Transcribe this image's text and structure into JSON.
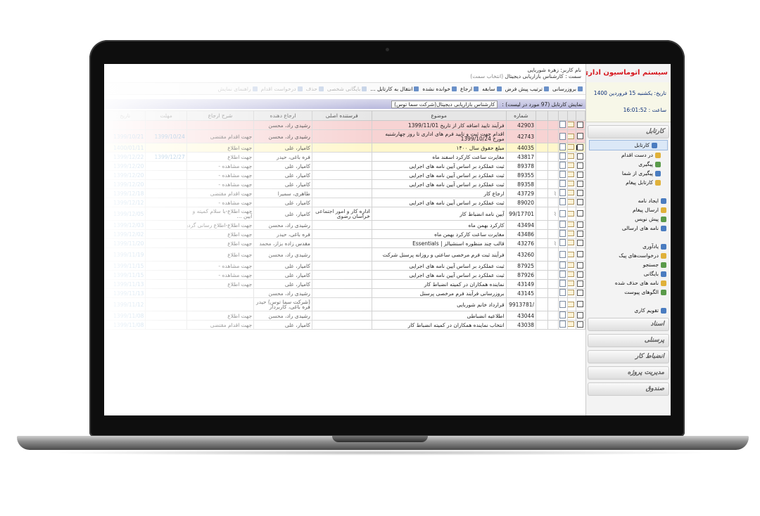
{
  "app": {
    "title": "سیستم اتوماسیون اداری پیوند",
    "date": "تاریخ: یکشنبه 15 فروردین 1400",
    "time": "ساعت : 16:01:52"
  },
  "user": {
    "name": "نام کاربر: زهره شوربایی",
    "role": "سمت : کارشناس بازاریابی دیجیتال",
    "role_hint": "(انتخاب سمت)"
  },
  "sidebar": {
    "sections": [
      {
        "label": "کارتابل",
        "items": [
          {
            "label": "کارتابل",
            "active": true,
            "sub": true,
            "icon": "inbox-icon"
          },
          {
            "label": "در دست اقدام",
            "sub": true,
            "icon": "folder-icon"
          },
          {
            "label": "پیگیری",
            "sub": true,
            "icon": "folder-icon"
          },
          {
            "label": "پیگیری از شما",
            "sub": true,
            "icon": "folder-icon"
          },
          {
            "label": "کارتابل پیغام",
            "sub": true,
            "icon": "message-icon"
          }
        ]
      },
      {
        "label": "",
        "items": [
          {
            "label": "ایجاد نامه",
            "icon": "new-letter-icon"
          },
          {
            "label": "ارسال پیغام",
            "icon": "send-icon"
          },
          {
            "label": "پیش نویس",
            "icon": "draft-icon"
          },
          {
            "label": "نامه های ارسالی",
            "icon": "sent-icon"
          }
        ]
      },
      {
        "label": "",
        "items": [
          {
            "label": "یادآوری",
            "icon": "reminder-icon"
          },
          {
            "label": "درخواست‌های پیک",
            "icon": "courier-icon"
          },
          {
            "label": "جستجو",
            "icon": "search-icon"
          },
          {
            "label": "بایگانی",
            "icon": "archive-icon"
          },
          {
            "label": "نامه های حذف شده",
            "icon": "trash-icon"
          },
          {
            "label": "الگوهای پیوست",
            "icon": "attachment-icon"
          }
        ]
      },
      {
        "label": "",
        "items": [
          {
            "label": "تقویم کاری",
            "icon": "calendar-icon"
          }
        ]
      }
    ],
    "modules": [
      "اسناد",
      "پرسنلی",
      "انضباط کار",
      "مدیریت پروژه",
      "صندوق"
    ]
  },
  "toolbar": [
    {
      "label": "بروزرسانی",
      "faded": false
    },
    {
      "label": "ترتیب پیش فرض",
      "faded": false
    },
    {
      "label": "سابقه",
      "faded": false
    },
    {
      "label": "ارجاع",
      "faded": false
    },
    {
      "label": "خوانده نشده",
      "faded": false
    },
    {
      "label": "انتقال به کارتابل ...",
      "faded": false
    },
    {
      "label": "بایگانی شخصی",
      "faded": true
    },
    {
      "label": "حذف",
      "faded": true
    },
    {
      "label": "درخواست اقدام",
      "faded": true
    },
    {
      "label": "راهنمای نمایش",
      "faded": true
    }
  ],
  "cartable_title": "نمایش کارتابل (97 مورد در لیست) :",
  "cartable_select": "کارشناس بازاریابی دیجیتال(شرکت سما توس)",
  "columns": [
    "",
    "",
    "",
    "",
    "",
    "شماره",
    "موضوع",
    "فرستنده اصلی",
    "ارجاع دهنده",
    "شرح ارجاع",
    "مهلت",
    "تاریخ"
  ],
  "rows": [
    {
      "num": "42903",
      "subject": "فرآیند تایید اضافه کار از تاریخ 1399/11/01",
      "sender": "",
      "referrer": "رشیدی راد، محسن",
      "note": "",
      "deadline": "",
      "date": "",
      "style": "hl",
      "clip": false
    },
    {
      "num": "42743",
      "subject": "اقدام جهت ثبت و تایید فرم های اداری تا روز چهارشنبه مورخ 1399/10/24",
      "sender": "",
      "referrer": "رشیدی راد، محسن",
      "note": "جهت اقدام مقتضی",
      "deadline": "1399/10/24",
      "date": "1399/10/21",
      "style": "hl tall",
      "clip": false
    },
    {
      "num": "44035",
      "subject": "مبلغ حقوق سال ۱۴۰۰",
      "sender": "",
      "referrer": "کامیار، علی",
      "note": "جهت اطلاع",
      "deadline": "",
      "date": "1400/01/11",
      "style": "cur",
      "clip": false
    },
    {
      "num": "43817",
      "subject": "مغایرت ساعت کارکرد اسفند ماه",
      "sender": "",
      "referrer": "فره باغی، حیدر",
      "note": "جهت اطلاع",
      "deadline": "1399/12/27",
      "date": "1399/12/22",
      "style": "",
      "clip": false
    },
    {
      "num": "89378",
      "subject": "ثبت عملکرد بر اساس آیین نامه های اجرایی",
      "sender": "",
      "referrer": "کامیار، علی",
      "note": "جهت مشاهده -",
      "deadline": "",
      "date": "1399/12/20",
      "style": "",
      "clip": false
    },
    {
      "num": "89355",
      "subject": "ثبت عملکرد بر اساس آیین نامه های اجرایی",
      "sender": "",
      "referrer": "کامیار، علی",
      "note": "جهت مشاهده -",
      "deadline": "",
      "date": "1399/12/20",
      "style": "",
      "clip": false
    },
    {
      "num": "89358",
      "subject": "ثبت عملکرد بر اساس آیین نامه های اجرایی",
      "sender": "",
      "referrer": "کامیار، علی",
      "note": "جهت مشاهده -",
      "deadline": "",
      "date": "1399/12/20",
      "style": "",
      "clip": false
    },
    {
      "num": "43729",
      "subject": "ارجاع کار",
      "sender": "",
      "referrer": "طاهری، سمیرا",
      "note": "جهت اقدام مقتضی",
      "deadline": "",
      "date": "1399/12/18",
      "style": "",
      "clip": true
    },
    {
      "num": "89020",
      "subject": "ثبت عملکرد بر اساس آیین نامه های اجرایی",
      "sender": "",
      "referrer": "کامیار، علی",
      "note": "جهت مشاهده -",
      "deadline": "",
      "date": "1399/12/12",
      "style": "",
      "clip": false
    },
    {
      "num": "99/17701",
      "subject": "آیین نامه انضباط کار",
      "sender": "اداره کار و امور اجتماعی خراسان رضوی",
      "referrer": "کامیار، علی",
      "note": "جهت اطلاع-با سلام کمیته و آیین ...",
      "deadline": "",
      "date": "1399/12/05",
      "style": "tall",
      "clip": true
    },
    {
      "num": "43494",
      "subject": "کارکرد بهمن ماه",
      "sender": "",
      "referrer": "رشیدی راد، محسن",
      "note": "جهت اطلاع-اطلاع رسانی گردید و",
      "deadline": "",
      "date": "1399/12/03",
      "style": "",
      "clip": false
    },
    {
      "num": "43486",
      "subject": "مغایرت ساعت کارکرد بهمن ماه",
      "sender": "",
      "referrer": "فره باغی، حیدر",
      "note": "جهت اطلاع",
      "deadline": "",
      "date": "1399/12/02",
      "style": "",
      "clip": false
    },
    {
      "num": "43276",
      "subject": "قالب چند منظوره اسنشیالز | Essentials",
      "sender": "",
      "referrer": "مقدس زاده بزاز، محمد",
      "note": "جهت اطلاع",
      "deadline": "",
      "date": "1399/11/20",
      "style": "",
      "clip": true
    },
    {
      "num": "43260",
      "subject": "فرآیند ثبت فرم مرخصی ساعتی و روزانه پرسنل شرکت",
      "sender": "",
      "referrer": "رشیدی راد، محسن",
      "note": "جهت اطلاع",
      "deadline": "",
      "date": "1399/11/19",
      "style": "tall",
      "clip": false
    },
    {
      "num": "87925",
      "subject": "ثبت عملکرد بر اساس آیین نامه های اجرایی",
      "sender": "",
      "referrer": "کامیار، علی",
      "note": "جهت مشاهده -",
      "deadline": "",
      "date": "1399/11/15",
      "style": "",
      "clip": false
    },
    {
      "num": "87926",
      "subject": "ثبت عملکرد بر اساس آیین نامه های اجرایی",
      "sender": "",
      "referrer": "کامیار، علی",
      "note": "جهت مشاهده -",
      "deadline": "",
      "date": "1399/11/15",
      "style": "",
      "clip": false
    },
    {
      "num": "43149",
      "subject": "نماینده همکاران در کمیته انضباط کار",
      "sender": "",
      "referrer": "کامیار، علی",
      "note": "جهت اطلاع",
      "deadline": "",
      "date": "1399/11/13",
      "style": "",
      "clip": false
    },
    {
      "num": "43145",
      "subject": "بروزرسانی فرآیند فرم مرخصی پرسنل",
      "sender": "",
      "referrer": "رشیدی راد، محسن",
      "note": "",
      "deadline": "",
      "date": "1399/11/13",
      "style": "",
      "clip": false
    },
    {
      "num": "9913781/",
      "subject": "قرارداد خانم شوربایی",
      "sender": "",
      "referrer": "(شرکت سما توس) حیدر فره باغی، کاربرداز",
      "note": "",
      "deadline": "",
      "date": "1399/11/12",
      "style": "tall",
      "clip": false
    },
    {
      "num": "43044",
      "subject": "اطلاعیه انضباطی",
      "sender": "",
      "referrer": "رشیدی راد، محسن",
      "note": "جهت اطلاع",
      "deadline": "",
      "date": "1399/11/08",
      "style": "",
      "clip": false
    },
    {
      "num": "43038",
      "subject": "انتخاب نماینده همکاران در کمیته انضباط کار",
      "sender": "",
      "referrer": "کامیار، علی",
      "note": "جهت اقدام مقتضی",
      "deadline": "",
      "date": "1399/11/08",
      "style": "",
      "clip": false
    }
  ]
}
